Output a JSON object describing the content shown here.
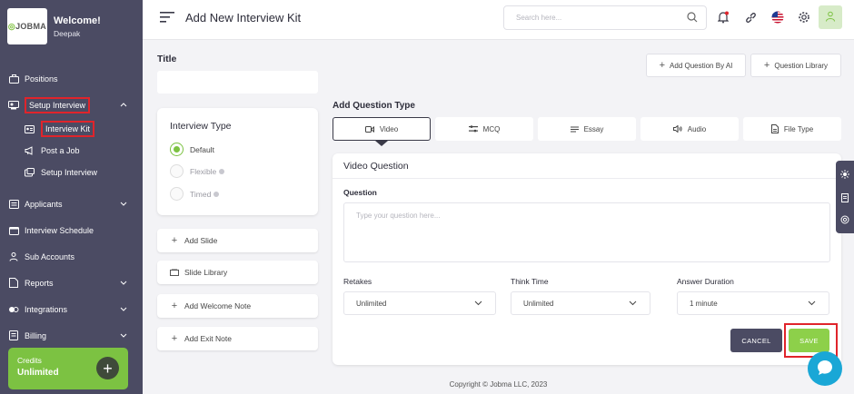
{
  "sidebar": {
    "logo": "JOBMA",
    "welcome": "Welcome!",
    "user": "Deepak",
    "items": [
      {
        "label": "Positions",
        "icon": "positions-icon"
      },
      {
        "label": "Setup Interview",
        "icon": "setup-interview-icon"
      },
      {
        "label": "Applicants",
        "icon": "applicants-icon"
      },
      {
        "label": "Interview Schedule",
        "icon": "calendar-icon"
      },
      {
        "label": "Sub Accounts",
        "icon": "users-icon"
      },
      {
        "label": "Reports",
        "icon": "reports-icon"
      },
      {
        "label": "Integrations",
        "icon": "integrations-icon"
      },
      {
        "label": "Billing",
        "icon": "billing-icon"
      }
    ],
    "subitems": [
      {
        "label": "Interview Kit",
        "icon": "kit-icon"
      },
      {
        "label": "Post a Job",
        "icon": "megaphone-icon"
      },
      {
        "label": "Setup Interview",
        "icon": "setup-icon"
      }
    ],
    "credits": {
      "label": "Credits",
      "value": "Unlimited"
    }
  },
  "topbar": {
    "title": "Add New Interview Kit",
    "search_placeholder": "Search here..."
  },
  "form": {
    "title_label": "Title",
    "title_value": "",
    "interview_type": {
      "title": "Interview Type",
      "options": [
        "Default",
        "Flexible",
        "Timed"
      ],
      "selected": "Default"
    },
    "actions": [
      "Add Slide",
      "Slide Library",
      "Add Welcome Note",
      "Add Exit Note"
    ],
    "add_question_ai": "Add Question By AI",
    "question_library": "Question Library",
    "add_question_type_label": "Add Question Type",
    "tabs": [
      "Video",
      "MCQ",
      "Essay",
      "Audio",
      "File Type"
    ],
    "active_tab": "Video",
    "video_question": {
      "title": "Video Question",
      "question_label": "Question",
      "question_placeholder": "Type your question here...",
      "retakes_label": "Retakes",
      "retakes_value": "Unlimited",
      "think_time_label": "Think Time",
      "think_time_value": "Unlimited",
      "answer_duration_label": "Answer Duration",
      "answer_duration_value": "1 minute",
      "cancel": "CANCEL",
      "save": "SAVE"
    }
  },
  "footer": "Copyright © Jobma LLC, 2023",
  "colors": {
    "sidebar": "#4b4b63",
    "accent": "#7cc242",
    "highlight": "#e0242b",
    "chat": "#1aa7d6"
  }
}
